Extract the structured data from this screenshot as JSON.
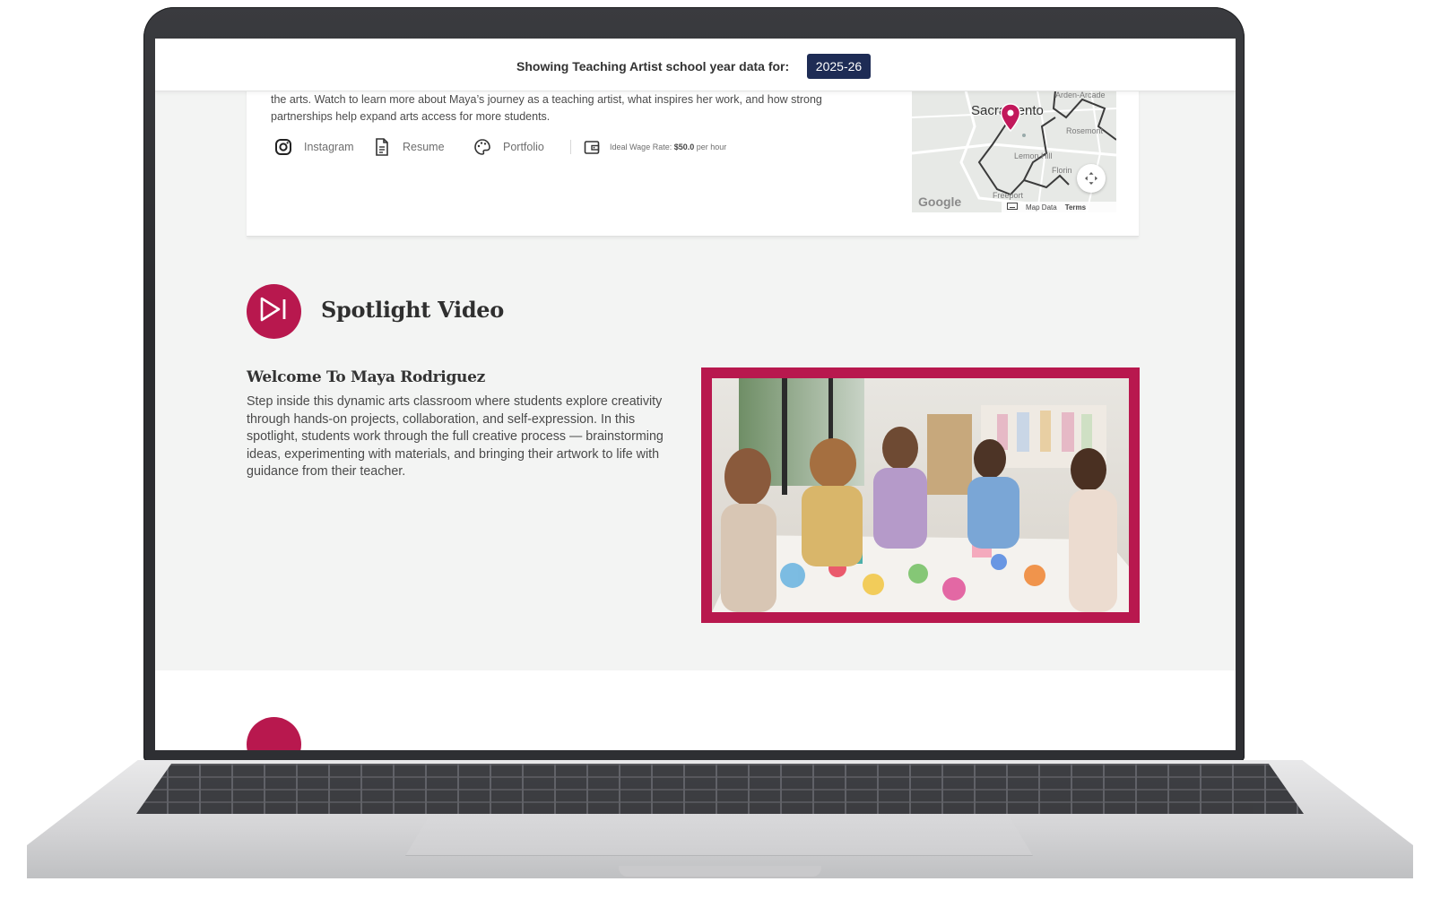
{
  "header": {
    "label": "Showing Teaching Artist school year data for:",
    "year": "2025-26"
  },
  "profile": {
    "bio_line1": "the arts. Watch to learn more about Maya’s journey as a teaching artist, what inspires her work, and how strong",
    "bio_line2": "partnerships help expand arts access for more students.",
    "links": {
      "instagram": "Instagram",
      "resume": "Resume",
      "portfolio": "Portfolio"
    },
    "wage_label": "Ideal Wage Rate:",
    "wage_value": "$50.0",
    "wage_unit": "per hour"
  },
  "map": {
    "city": "Sacramento",
    "places": [
      "Arden-Arcade",
      "Rosemont",
      "Lemon Hill",
      "Florin",
      "Freeport"
    ],
    "logo": "Google",
    "map_data": "Map Data",
    "terms": "Terms"
  },
  "spotlight": {
    "section_title": "Spotlight Video",
    "welcome_title": "Welcome To Maya Rodriguez",
    "description": "Step inside this dynamic arts classroom where students explore creativity through hands-on projects, collaboration, and self-expression. In this spotlight, students work through the full creative process — brainstorming ideas, experimenting with materials, and bringing their artwork to life with guidance from their teacher."
  },
  "colors": {
    "accent": "#b8184e",
    "navy": "#1e2c55",
    "page_bg": "#f3f4f3"
  },
  "icons": [
    "instagram-icon",
    "document-icon",
    "palette-icon",
    "wallet-icon",
    "play-icon",
    "map-pin-icon",
    "fullscreen-icon",
    "keyboard-icon"
  ]
}
